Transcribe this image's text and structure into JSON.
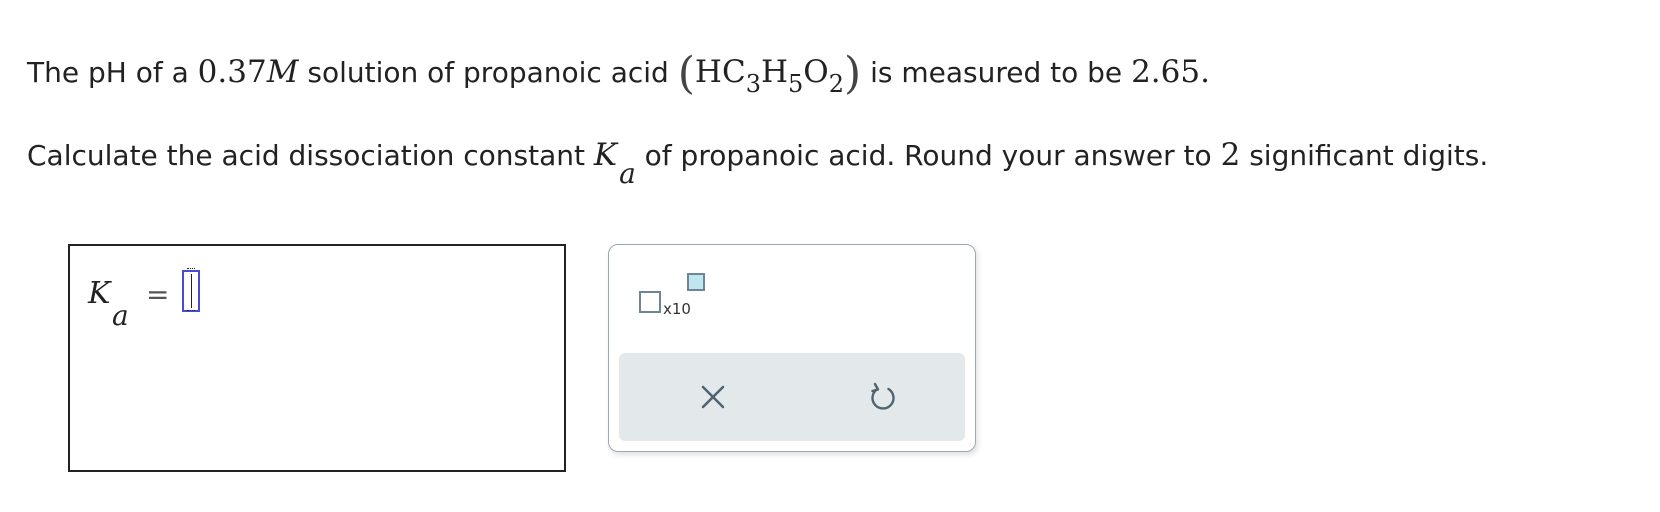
{
  "question": {
    "line1": {
      "prefix": "The pH of a",
      "concentration": "0.37",
      "unit": "M",
      "middle": "solution of propanoic acid",
      "formula": {
        "H": "H",
        "C": "C",
        "c_count": "3",
        "H2": "H",
        "h_count": "5",
        "O": "O",
        "o_count": "2"
      },
      "suffix": "is measured to be",
      "ph_value": "2.65",
      "period": "."
    },
    "line2": {
      "prefix": "Calculate the acid dissociation constant",
      "symbol": "K",
      "symbol_sub": "a",
      "middle": "of propanoic acid. Round your answer to",
      "sig_digits": "2",
      "suffix": "significant digits."
    }
  },
  "answer": {
    "label": "K",
    "label_sub": "a",
    "equals": "=",
    "value": ""
  },
  "tools": {
    "sci_notation_label": "x10",
    "clear_icon": "close-icon",
    "reset_icon": "undo-icon"
  },
  "colors": {
    "input_border": "#4a4ad8",
    "icon_stroke": "#4f6470",
    "action_bar_bg": "#e3e8eb",
    "exponent_fill": "#bfe6ee"
  }
}
